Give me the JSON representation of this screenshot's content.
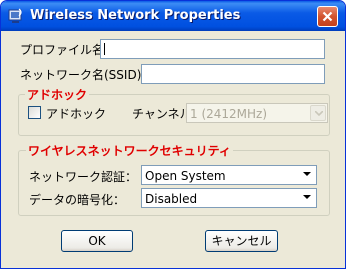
{
  "window": {
    "title": "Wireless Network Properties",
    "icon": "wireless-network-icon",
    "close_icon": "close-icon"
  },
  "profile": {
    "label": "プロファイル名：",
    "value": ""
  },
  "ssid": {
    "label": "ネットワーク名(SSID)：",
    "value": ""
  },
  "adhoc_group": {
    "title": "アドホック",
    "checkbox_label": "アドホック",
    "checked": false,
    "channel_label": "チャンネル：",
    "channel_value": "1  (2412MHz)"
  },
  "security_group": {
    "title": "ワイヤレスネットワークセキュリティ",
    "auth_label": "ネットワーク認証：",
    "auth_value": "Open System",
    "encryption_label": "データの暗号化：",
    "encryption_value": "Disabled"
  },
  "buttons": {
    "ok": "OK",
    "cancel": "キャンセル"
  },
  "colors": {
    "title_bar": "#0a5ae6",
    "group_title": "#e00000",
    "dialog_bg": "#ece9d8"
  }
}
